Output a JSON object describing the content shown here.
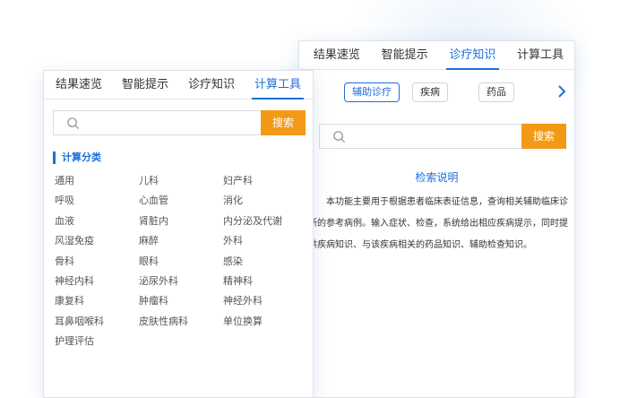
{
  "back_panel": {
    "tabs": [
      {
        "label": "结果速览"
      },
      {
        "label": "智能提示"
      },
      {
        "label": "诊疗知识",
        "active": true
      },
      {
        "label": "计算工具"
      }
    ],
    "chips": [
      "辅助诊疗",
      "疾病",
      "药品"
    ],
    "search": {
      "placeholder": "",
      "button_label": "搜索"
    },
    "explain_title": "检索说明",
    "explain_body": "本功能主要用于根据患者临床表征信息，查询相关辅助临床诊断的参考病例。输入症状、检查，系统给出相应疾病提示，同时提供疾病知识、与该疾病相关的药品知识、辅助检查知识。"
  },
  "front_panel": {
    "tabs": [
      {
        "label": "结果速览"
      },
      {
        "label": "智能提示"
      },
      {
        "label": "诊疗知识"
      },
      {
        "label": "计算工具",
        "active": true
      }
    ],
    "search": {
      "placeholder": "",
      "button_label": "搜索"
    },
    "category_title": "计算分类",
    "categories": [
      "通用",
      "儿科",
      "妇产科",
      "呼吸",
      "心血管",
      "消化",
      "血液",
      "肾脏内",
      "内分泌及代谢",
      "风湿免疫",
      "麻醉",
      "外科",
      "骨科",
      "眼科",
      "感染",
      "神经内科",
      "泌尿外科",
      "精神科",
      "康复科",
      "肿瘤科",
      "神经外科",
      "耳鼻咽喉科",
      "皮肤性病科",
      "单位换算",
      "护理评估"
    ]
  },
  "colors": {
    "accent": "#1e6fd9",
    "button": "#f29a16",
    "border": "#dde3ea"
  },
  "icons": {
    "search": "search-icon",
    "next": "chevron-right-icon"
  }
}
